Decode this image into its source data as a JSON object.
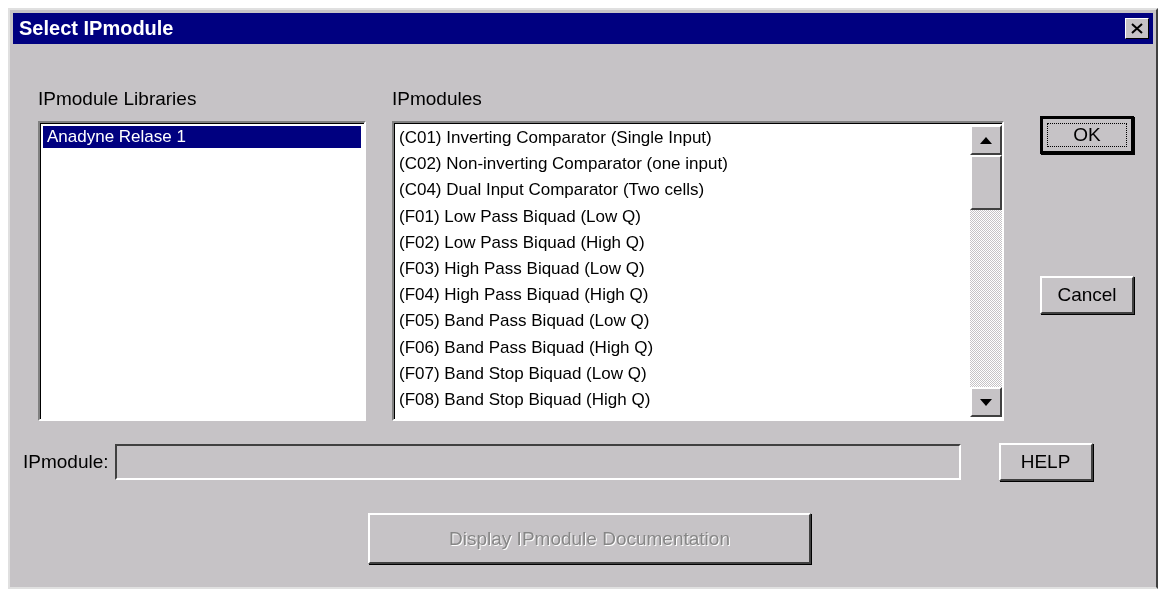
{
  "window": {
    "title": "Select IPmodule"
  },
  "libraries": {
    "label": "IPmodule Libraries",
    "items": [
      {
        "text": "Anadyne Relase 1",
        "selected": true
      }
    ]
  },
  "modules": {
    "label": "IPmodules",
    "items": [
      {
        "text": "(C01) Inverting Comparator (Single Input)",
        "selected": false
      },
      {
        "text": "(C02) Non-inverting Comparator (one input)",
        "selected": false
      },
      {
        "text": "(C04) Dual Input Comparator (Two cells)",
        "selected": false
      },
      {
        "text": "(F01) Low Pass Biquad (Low Q)",
        "selected": false
      },
      {
        "text": "(F02) Low Pass Biquad (High Q)",
        "selected": false
      },
      {
        "text": "(F03) High Pass Biquad (Low Q)",
        "selected": false
      },
      {
        "text": "(F04) High Pass Biquad (High Q)",
        "selected": false
      },
      {
        "text": "(F05) Band Pass Biquad (Low Q)",
        "selected": false
      },
      {
        "text": "(F06) Band Pass Biquad (High Q)",
        "selected": false
      },
      {
        "text": "(F07) Band Stop Biquad (Low Q)",
        "selected": false
      },
      {
        "text": "(F08) Band Stop Biquad (High Q)",
        "selected": false
      }
    ]
  },
  "side_buttons": [
    {
      "label": "OK",
      "default": true
    },
    {
      "label": "Cancel",
      "default": false
    }
  ],
  "ipmodule_field": {
    "label": "IPmodule:"
  },
  "help_button": {
    "label": "HELP"
  },
  "documentation_button": {
    "label": "Display IPmodule Documentation",
    "disabled": true
  }
}
